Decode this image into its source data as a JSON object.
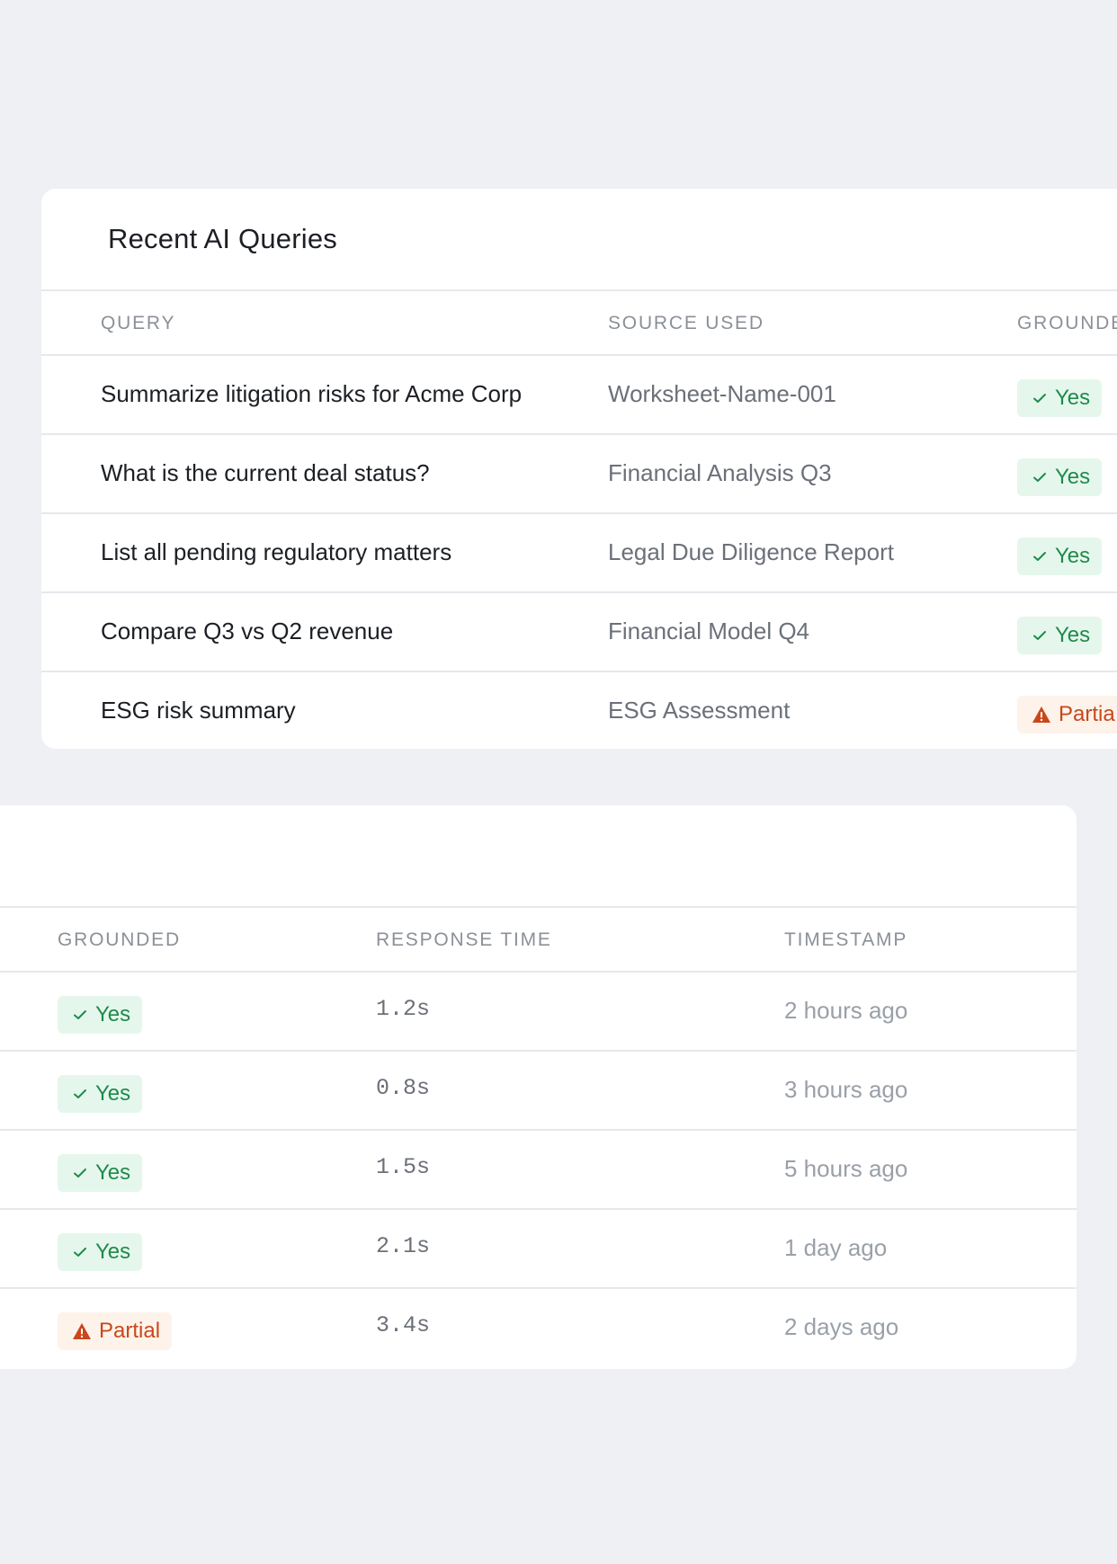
{
  "top_card": {
    "title": "Recent AI Queries",
    "columns": {
      "query": "QUERY",
      "source": "SOURCE USED",
      "grounded": "GROUNDE"
    },
    "rows": [
      {
        "query": "Summarize litigation risks for Acme Corp",
        "source": "Worksheet-Name-001",
        "grounded": "Yes",
        "grounded_status": "yes"
      },
      {
        "query": "What is the current deal status?",
        "source": "Financial Analysis Q3",
        "grounded": "Yes",
        "grounded_status": "yes"
      },
      {
        "query": "List all pending regulatory matters",
        "source": "Legal Due Diligence Report",
        "grounded": "Yes",
        "grounded_status": "yes"
      },
      {
        "query": "Compare Q3 vs Q2 revenue",
        "source": "Financial Model Q4",
        "grounded": "Yes",
        "grounded_status": "yes"
      },
      {
        "query": "ESG risk summary",
        "source": "ESG Assessment",
        "grounded": "Partia",
        "grounded_status": "partial"
      }
    ]
  },
  "bottom_card": {
    "columns": {
      "grounded": "GROUNDED",
      "response_time": "RESPONSE TIME",
      "timestamp": "TIMESTAMP"
    },
    "rows": [
      {
        "grounded": "Yes",
        "grounded_status": "yes",
        "response_time": "1.2s",
        "timestamp": "2 hours ago"
      },
      {
        "grounded": "Yes",
        "grounded_status": "yes",
        "response_time": "0.8s",
        "timestamp": "3 hours ago"
      },
      {
        "grounded": "Yes",
        "grounded_status": "yes",
        "response_time": "1.5s",
        "timestamp": "5 hours ago"
      },
      {
        "grounded": "Yes",
        "grounded_status": "yes",
        "response_time": "2.1s",
        "timestamp": "1 day ago"
      },
      {
        "grounded": "Partial",
        "grounded_status": "partial",
        "response_time": "3.4s",
        "timestamp": "2 days ago"
      }
    ]
  },
  "colors": {
    "page_bg": "#eef0f4",
    "card_bg": "#ffffff",
    "yes_bg": "#e5f7ec",
    "yes_text": "#1f8a4c",
    "partial_bg": "#fdf3ea",
    "partial_text": "#c9471b"
  },
  "icons": {
    "yes": "check-icon",
    "partial": "warning-triangle-icon"
  }
}
